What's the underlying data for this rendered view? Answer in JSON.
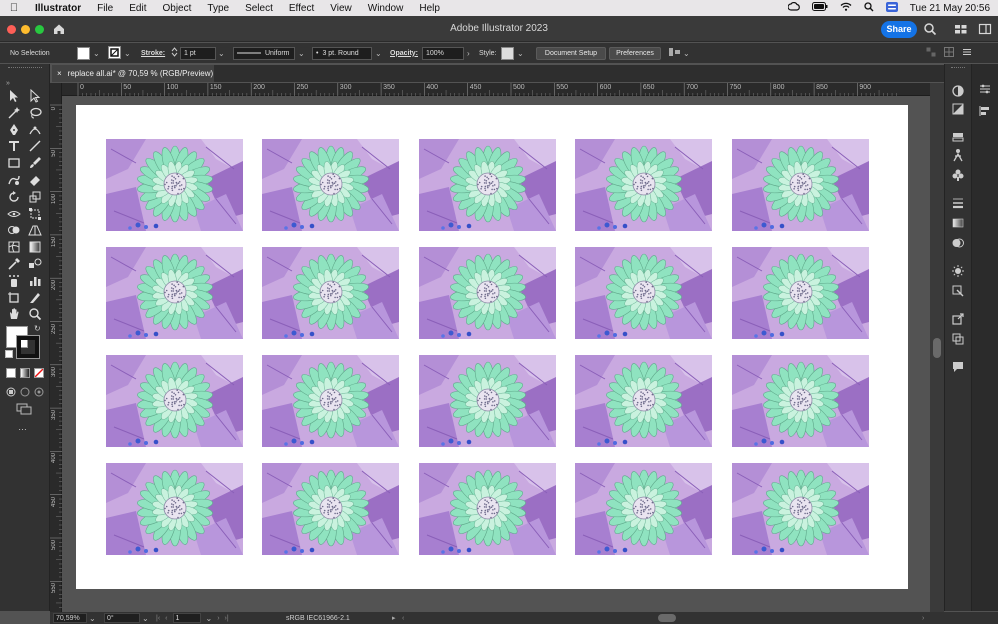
{
  "menubar": {
    "app_name": "Illustrator",
    "items": [
      "File",
      "Edit",
      "Object",
      "Type",
      "Select",
      "Effect",
      "View",
      "Window",
      "Help"
    ],
    "clock": "Tue 21 May  20:56"
  },
  "titlebar": {
    "title": "Adobe Illustrator 2023",
    "share_label": "Share"
  },
  "controlbar": {
    "selection_status": "No Selection",
    "stroke_label": "Stroke:",
    "stroke_weight": "1 pt",
    "profile_label": "Uniform",
    "brush_label": "3 pt. Round",
    "opacity_label": "Opacity:",
    "opacity_value": "100%",
    "style_label": "Style:",
    "document_setup_label": "Document Setup",
    "preferences_label": "Preferences"
  },
  "document": {
    "tab_title": "replace all.ai* @ 70,59 % (RGB/Preview)"
  },
  "rulers": {
    "horizontal": [
      "0",
      "50",
      "100",
      "150",
      "200",
      "250",
      "300",
      "350",
      "400",
      "450",
      "500",
      "550",
      "600",
      "650",
      "700",
      "750",
      "800",
      "850",
      "900"
    ],
    "vertical": [
      "0",
      "50",
      "100",
      "150",
      "200",
      "250",
      "300",
      "350",
      "400",
      "450",
      "500",
      "550",
      "600"
    ]
  },
  "artboard": {
    "rows": 4,
    "columns": 5,
    "image_description_name": "inverted-sunflower-image"
  },
  "statusbar": {
    "zoom": "70,59%",
    "rotation": "0°",
    "artboard_number": "1",
    "color_profile": "sRGB IEC61966-2.1"
  },
  "colors": {
    "accent_blue": "#1473e6",
    "panel_dark": "#323232",
    "canvas_gray": "#535353",
    "close": "#fe5f57",
    "minimize": "#febc2e",
    "zoom": "#28c840",
    "petal_green": "#8fe3c0",
    "leaf_purple": "#9b6fc4",
    "background_lilac": "#c9a9e0"
  }
}
